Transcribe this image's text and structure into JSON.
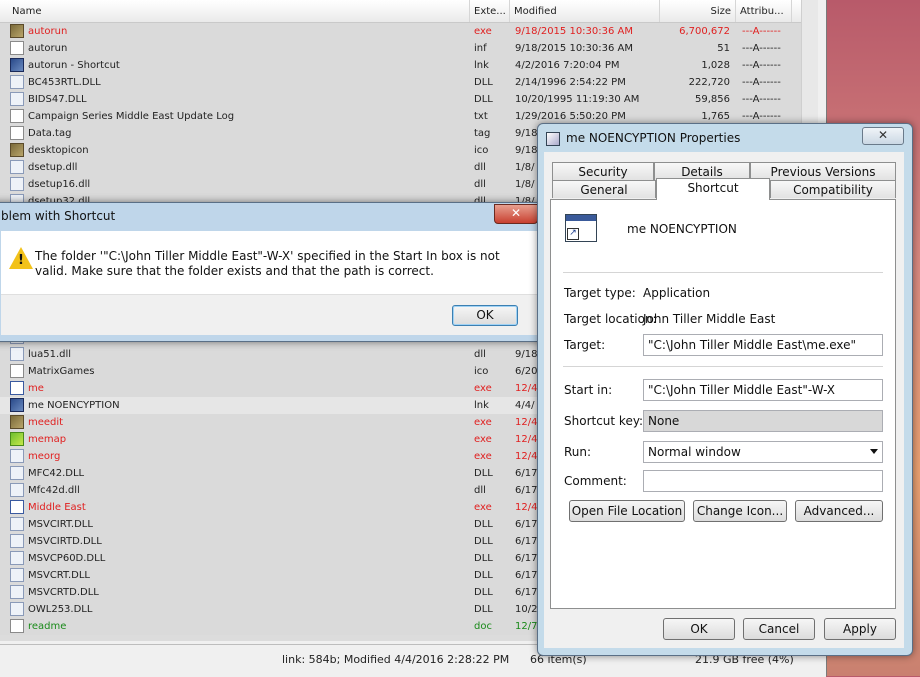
{
  "explorer": {
    "columns": {
      "name": "Name",
      "ext": "Exte...",
      "modified": "Modified",
      "size": "Size",
      "attrib": "Attribu..."
    },
    "rows": [
      {
        "name": "autorun",
        "ext": "exe",
        "modified": "9/18/2015 10:30:36 AM",
        "size": "6,700,672",
        "attrib": "---A------",
        "style": "red",
        "icon": "img"
      },
      {
        "name": "autorun",
        "ext": "inf",
        "modified": "9/18/2015 10:30:36 AM",
        "size": "51",
        "attrib": "---A------",
        "style": "",
        "icon": "doc"
      },
      {
        "name": "autorun - Shortcut",
        "ext": "lnk",
        "modified": "4/2/2016 7:20:04 PM",
        "size": "1,028",
        "attrib": "---A------",
        "style": "",
        "icon": "sc"
      },
      {
        "name": "BC453RTL.DLL",
        "ext": "DLL",
        "modified": "2/14/1996 2:54:22 PM",
        "size": "222,720",
        "attrib": "---A------",
        "style": "",
        "icon": "dll"
      },
      {
        "name": "BIDS47.DLL",
        "ext": "DLL",
        "modified": "10/20/1995 11:19:30 AM",
        "size": "59,856",
        "attrib": "---A------",
        "style": "",
        "icon": "dll"
      },
      {
        "name": "Campaign Series Middle East Update Log",
        "ext": "txt",
        "modified": "1/29/2016 5:50:20 PM",
        "size": "1,765",
        "attrib": "---A------",
        "style": "",
        "icon": "doc"
      },
      {
        "name": "Data.tag",
        "ext": "tag",
        "modified": "9/18",
        "size": "",
        "attrib": "",
        "style": "",
        "icon": "doc"
      },
      {
        "name": "desktopicon",
        "ext": "ico",
        "modified": "9/18",
        "size": "",
        "attrib": "",
        "style": "",
        "icon": "img"
      },
      {
        "name": "dsetup.dll",
        "ext": "dll",
        "modified": "1/8/",
        "size": "",
        "attrib": "",
        "style": "",
        "icon": "dll"
      },
      {
        "name": "dsetup16.dll",
        "ext": "dll",
        "modified": "1/8/",
        "size": "",
        "attrib": "",
        "style": "",
        "icon": "dll"
      },
      {
        "name": "dsetup32.dll",
        "ext": "dll",
        "modified": "1/8/",
        "size": "",
        "attrib": "",
        "style": "",
        "icon": "dll"
      },
      {
        "name": "",
        "ext": "",
        "modified": "",
        "size": "",
        "attrib": "",
        "style": "",
        "icon": "dll"
      },
      {
        "name": "",
        "ext": "",
        "modified": "",
        "size": "",
        "attrib": "",
        "style": "",
        "icon": "dll"
      },
      {
        "name": "",
        "ext": "",
        "modified": "",
        "size": "",
        "attrib": "",
        "style": "",
        "icon": "dll"
      },
      {
        "name": "",
        "ext": "",
        "modified": "",
        "size": "",
        "attrib": "",
        "style": "",
        "icon": "dll"
      },
      {
        "name": "",
        "ext": "",
        "modified": "",
        "size": "",
        "attrib": "",
        "style": "",
        "icon": "dll"
      },
      {
        "name": "",
        "ext": "",
        "modified": "",
        "size": "",
        "attrib": "",
        "style": "",
        "icon": "dll"
      },
      {
        "name": "",
        "ext": "",
        "modified": "",
        "size": "",
        "attrib": "",
        "style": "",
        "icon": "dll"
      },
      {
        "name": "",
        "ext": "",
        "modified": "",
        "size": "",
        "attrib": "",
        "style": "",
        "icon": "dll"
      },
      {
        "name": "lua51.dll",
        "ext": "dll",
        "modified": "9/18",
        "size": "",
        "attrib": "",
        "style": "",
        "icon": "dll"
      },
      {
        "name": "MatrixGames",
        "ext": "ico",
        "modified": "6/20",
        "size": "",
        "attrib": "",
        "style": "",
        "icon": "doc"
      },
      {
        "name": "me",
        "ext": "exe",
        "modified": "12/4",
        "size": "",
        "attrib": "",
        "style": "red",
        "icon": "star"
      },
      {
        "name": "me NOENCYPTION",
        "ext": "lnk",
        "modified": "4/4/",
        "size": "",
        "attrib": "",
        "style": "sel",
        "icon": "sc"
      },
      {
        "name": "meedit",
        "ext": "exe",
        "modified": "12/4",
        "size": "",
        "attrib": "",
        "style": "red",
        "icon": "img"
      },
      {
        "name": "memap",
        "ext": "exe",
        "modified": "12/4",
        "size": "",
        "attrib": "",
        "style": "red",
        "icon": "grn"
      },
      {
        "name": "meorg",
        "ext": "exe",
        "modified": "12/4",
        "size": "",
        "attrib": "",
        "style": "red",
        "icon": "dll"
      },
      {
        "name": "MFC42.DLL",
        "ext": "DLL",
        "modified": "6/17",
        "size": "",
        "attrib": "",
        "style": "",
        "icon": "dll"
      },
      {
        "name": "Mfc42d.dll",
        "ext": "dll",
        "modified": "6/17",
        "size": "",
        "attrib": "",
        "style": "",
        "icon": "dll"
      },
      {
        "name": "Middle East",
        "ext": "exe",
        "modified": "12/4",
        "size": "",
        "attrib": "",
        "style": "red",
        "icon": "star"
      },
      {
        "name": "MSVCIRT.DLL",
        "ext": "DLL",
        "modified": "6/17",
        "size": "",
        "attrib": "",
        "style": "",
        "icon": "dll"
      },
      {
        "name": "MSVCIRTD.DLL",
        "ext": "DLL",
        "modified": "6/17",
        "size": "",
        "attrib": "",
        "style": "",
        "icon": "dll"
      },
      {
        "name": "MSVCP60D.DLL",
        "ext": "DLL",
        "modified": "6/17",
        "size": "",
        "attrib": "",
        "style": "",
        "icon": "dll"
      },
      {
        "name": "MSVCRT.DLL",
        "ext": "DLL",
        "modified": "6/17",
        "size": "",
        "attrib": "",
        "style": "",
        "icon": "dll"
      },
      {
        "name": "MSVCRTD.DLL",
        "ext": "DLL",
        "modified": "6/17",
        "size": "",
        "attrib": "",
        "style": "",
        "icon": "dll"
      },
      {
        "name": "OWL253.DLL",
        "ext": "DLL",
        "modified": "10/2",
        "size": "",
        "attrib": "",
        "style": "",
        "icon": "dll"
      },
      {
        "name": "readme",
        "ext": "doc",
        "modified": "12/7",
        "size": "",
        "attrib": "",
        "style": "grnt",
        "icon": "doc"
      }
    ],
    "status": {
      "link_info": "link: 584b; Modified 4/4/2016 2:28:22 PM",
      "items": "66 item(s)",
      "free": "21.9 GB free (4%)"
    }
  },
  "problem_dialog": {
    "title": "blem with Shortcut",
    "close": "✕",
    "message": "The folder '\"C:\\John Tiller Middle East\"-W-X' specified in the Start In box is not valid. Make sure that the folder exists and that the path is correct.",
    "ok": "OK"
  },
  "properties_dialog": {
    "title": "me NOENCYPTION Properties",
    "close": "✕",
    "tabs_row1": [
      "Security",
      "Details",
      "Previous Versions"
    ],
    "tabs_row2": [
      "General",
      "Shortcut",
      "Compatibility"
    ],
    "shortcut_name": "me NOENCYPTION",
    "target_type_label": "Target type:",
    "target_type": "Application",
    "target_location_label": "Target location:",
    "target_location": "John Tiller Middle East",
    "target_label": "Target:",
    "target": "\"C:\\John Tiller Middle East\\me.exe\"",
    "start_in_label": "Start in:",
    "start_in": "\"C:\\John Tiller Middle East\"-W-X",
    "shortcut_key_label": "Shortcut key:",
    "shortcut_key": "None",
    "run_label": "Run:",
    "run": "Normal window",
    "comment_label": "Comment:",
    "comment": "",
    "btn_open_location": "Open File Location",
    "btn_change_icon": "Change Icon...",
    "btn_advanced": "Advanced...",
    "btn_ok": "OK",
    "btn_cancel": "Cancel",
    "btn_apply": "Apply"
  }
}
